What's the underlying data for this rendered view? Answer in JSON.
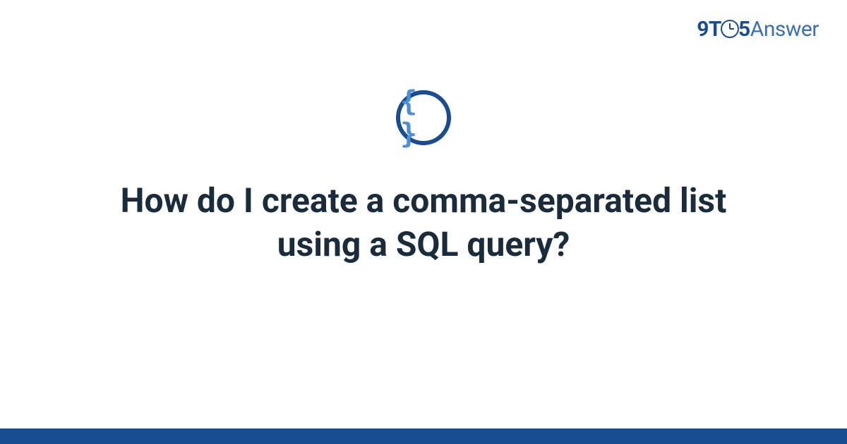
{
  "logo": {
    "part1": "9T",
    "part2": "5",
    "part3": "Answer"
  },
  "icon": {
    "name": "code-braces-icon",
    "glyph": "{ }"
  },
  "question": {
    "title": "How do I create a comma-separated list using a SQL query?"
  },
  "colors": {
    "brand_dark": "#1a4d8f",
    "brand_light": "#3a6fb5",
    "accent": "#4a8fd8",
    "text": "#1a2b3c"
  }
}
